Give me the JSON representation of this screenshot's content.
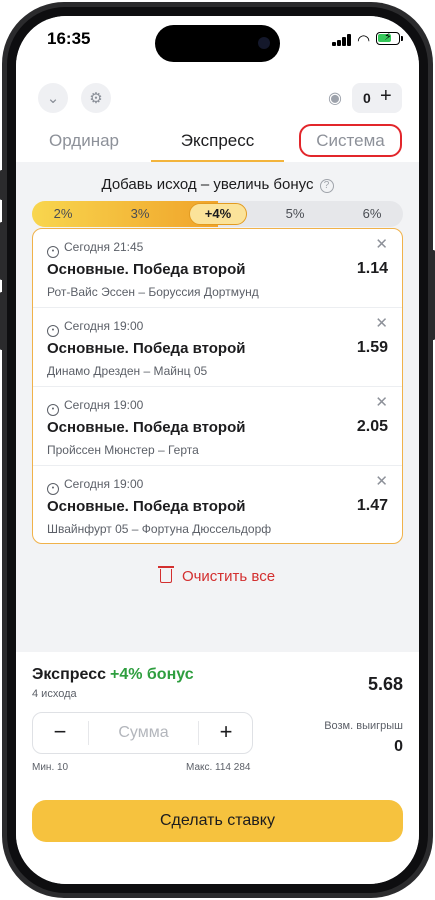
{
  "status_bar": {
    "time": "16:35",
    "icons": [
      "signal-icon",
      "wifi-icon",
      "battery-charging-icon"
    ]
  },
  "header": {
    "icons": [
      "chevron-down-icon",
      "gear-icon",
      "eye-icon"
    ],
    "counter": "0",
    "counter_plus": "+"
  },
  "tabs": [
    {
      "label": "Ординар",
      "active": false
    },
    {
      "label": "Экспресс",
      "active": true
    },
    {
      "label": "Система",
      "active": false
    }
  ],
  "bonus": {
    "title": "Добавь исход – увеличь бонус",
    "help": "?",
    "levels": [
      "2%",
      "3%",
      "+4%",
      "5%",
      "6%"
    ],
    "active_index": 2,
    "fill_fraction": 0.5
  },
  "bets": [
    {
      "time": "Сегодня 21:45",
      "market": "Основные. Победа второй",
      "odds": "1.14",
      "match": "Рот-Вайс Эссен – Боруссия Дортмунд"
    },
    {
      "time": "Сегодня 19:00",
      "market": "Основные. Победа второй",
      "odds": "1.59",
      "match": "Динамо Дрезден – Майнц 05"
    },
    {
      "time": "Сегодня 19:00",
      "market": "Основные. Победа второй",
      "odds": "2.05",
      "match": "Пройссен Мюнстер – Герта"
    },
    {
      "time": "Сегодня 19:00",
      "market": "Основные. Победа второй",
      "odds": "1.47",
      "match": "Швайнфурт 05 – Фортуна Дюссельдорф"
    }
  ],
  "clear_label": "Очистить все",
  "sheet": {
    "title": "Экспресс",
    "bonus": "+4% бонус",
    "count": "4 исхода",
    "total_odds": "5.68",
    "stake_placeholder": "Сумма",
    "minus": "−",
    "plus": "+",
    "min": "Мин. 10",
    "max": "Макс. 114 284",
    "win_label": "Возм. выигрыш",
    "win_value": "0",
    "bet_button": "Сделать ставку"
  },
  "colors": {
    "accent": "#f6c23e",
    "active_tab_line": "#f3b43c",
    "highlight": "#e2262b",
    "bonus_green": "#2e9e3f",
    "clear_red": "#d32f2f"
  }
}
